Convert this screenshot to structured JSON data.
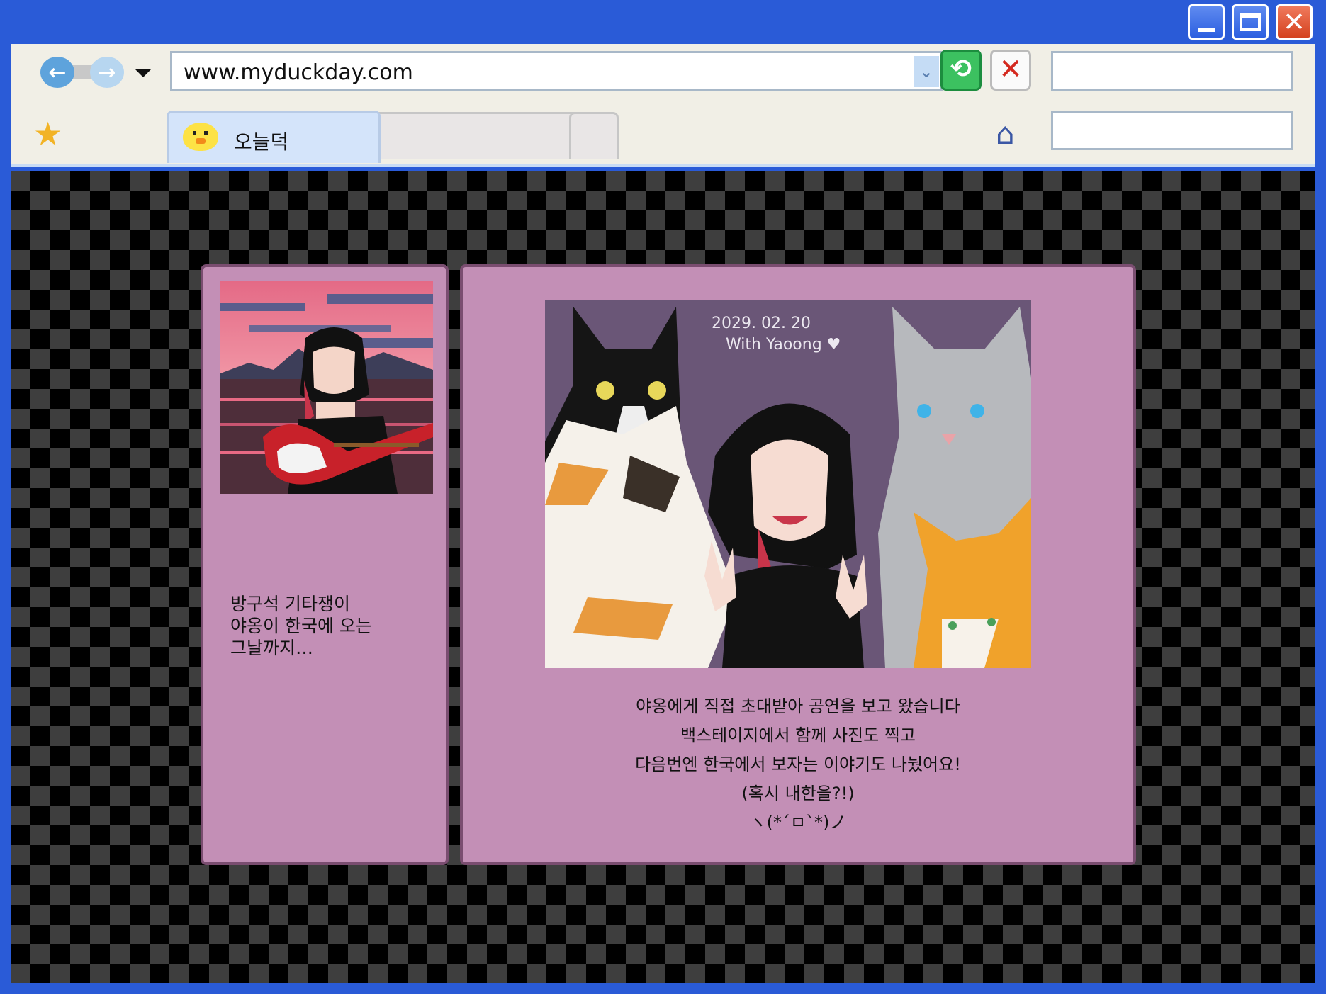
{
  "window": {
    "minimize_icon": "minimize-icon",
    "maximize_icon": "maximize-icon",
    "close_icon": "close-icon"
  },
  "toolbar": {
    "back_icon": "back-arrow-icon",
    "forward_icon": "forward-arrow-icon",
    "history_icon": "dropdown-arrow-icon",
    "address": "www.myduckday.com",
    "address_dropdown_icon": "chevron-down-icon",
    "refresh_icon": "refresh-icon",
    "stop_icon": "stop-x-icon",
    "search_value": ""
  },
  "tabs": {
    "favorites_icon": "star-icon",
    "items": [
      {
        "label": "오늘덕",
        "icon": "duck-icon",
        "active": true
      },
      {
        "label": "",
        "active": false
      },
      {
        "label": "",
        "active": false
      }
    ],
    "home_icon": "home-icon",
    "second_search_value": ""
  },
  "profile": {
    "bio": "방구석 기타쟁이\n야옹이 한국에 오는\n그날까지…"
  },
  "post": {
    "photo_caption_handwriting": "2029. 02. 20\nWith Yaoong ♥",
    "caption_lines": [
      "야옹에게 직접 초대받아 공연을 보고 왔습니다",
      "백스테이지에서 함께 사진도 찍고",
      "다음번엔 한국에서 보자는 이야기도 나눴어요!",
      "(혹시 내한을?!)",
      "ヽ(*´ㅁ`*)ノ"
    ]
  },
  "colors": {
    "frame": "#2a5bd7",
    "panel": "#c38fb6",
    "panel_border": "#7a4d70",
    "checker_dark": "#000000",
    "checker_light": "#3e3e3e"
  }
}
